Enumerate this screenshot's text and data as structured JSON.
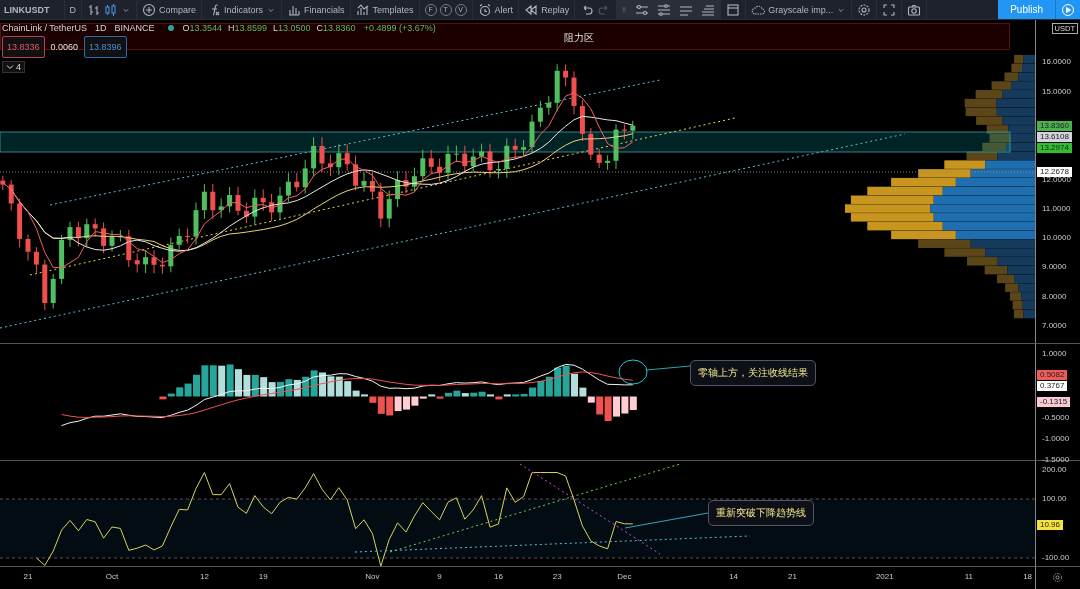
{
  "toolbar": {
    "symbol": "LINKUSDT",
    "interval": "D",
    "compare": "Compare",
    "indicators": "Indicators",
    "financials": "Financials",
    "templates": "Templates",
    "badges": [
      "F",
      "T",
      "V"
    ],
    "alert": "Alert",
    "replay": "Replay",
    "layout": "Grayscale imp...",
    "publish": "Publish"
  },
  "legend": {
    "pair": "ChainLink / TetherUS",
    "interval": "1D",
    "exchange": "BINANCE",
    "ohlc": [
      {
        "key": "O",
        "value": "13.3544"
      },
      {
        "key": "H",
        "value": "13.8599"
      },
      {
        "key": "L",
        "value": "13.0500"
      },
      {
        "key": "C",
        "value": "13.8360"
      }
    ],
    "change": "+0.4899 (+3.67%)",
    "bid": "13.8336",
    "spread": "0.0060",
    "ask": "13.8396",
    "collapsed_count": "4"
  },
  "zone": {
    "label": "阻力区"
  },
  "price_axis": {
    "unit": "USDT",
    "ticks": [
      "16.0000",
      "15.0000",
      "12.0000",
      "11.0000",
      "10.0000",
      "9.0000",
      "8.0000",
      "7.0000"
    ],
    "markers": [
      {
        "label": "13.8360",
        "color": "#4caf50"
      },
      {
        "label": "13.6108",
        "color": "#d1d4dc"
      },
      {
        "label": "13.2974",
        "color": "#2fbf2f"
      },
      {
        "label": "12.2678",
        "color": "#ffffff"
      }
    ]
  },
  "macd_pane": {
    "note": "零轴上方，关注收线结果",
    "ticks": [
      "1.0000",
      "-0.5000",
      "-1.0000",
      "-1.5000"
    ],
    "markers": [
      {
        "label": "0.5082",
        "color": "#f05a5a"
      },
      {
        "label": "0.3767",
        "color": "#ffffff"
      },
      {
        "label": "-0.1315",
        "color": "#f8c8d4"
      }
    ]
  },
  "cci_pane": {
    "note": "重新突破下降趋势线",
    "ticks": [
      "200.00",
      "100.00",
      "-100.00"
    ],
    "markers": [
      {
        "label": "10.96",
        "color": "#f5e33a"
      }
    ]
  },
  "time_axis": {
    "labels": [
      "21",
      "Oct",
      "12",
      "19",
      "Nov",
      "9",
      "16",
      "23",
      "Dec",
      "14",
      "21",
      "2021",
      "11",
      "18"
    ]
  }
}
